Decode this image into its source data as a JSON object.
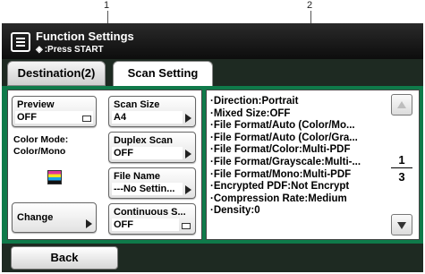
{
  "callouts": [
    "1",
    "2"
  ],
  "header": {
    "title": "Function Settings",
    "subtitle": ":Press START"
  },
  "tabs": [
    {
      "label": "Destination(2)",
      "active": false
    },
    {
      "label": "Scan Setting",
      "active": true
    }
  ],
  "left": {
    "preview": {
      "label": "Preview",
      "value": "OFF"
    },
    "color_mode": {
      "label": "Color Mode:",
      "value": "Color/Mono"
    },
    "change": {
      "label": "Change"
    },
    "scan_size": {
      "label": "Scan Size",
      "value": "A4"
    },
    "duplex_scan": {
      "label": "Duplex Scan",
      "value": "OFF"
    },
    "file_name": {
      "label": "File Name",
      "value": "---No Settin..."
    },
    "continuous_scan": {
      "label": "Continuous S...",
      "value": "OFF"
    }
  },
  "right": {
    "items": [
      "·Direction:Portrait",
      "·Mixed Size:OFF",
      "·File Format/Auto (Color/Mo...",
      "·File Format/Auto (Color/Gra...",
      "·File Format/Color:Multi-PDF",
      "·File Format/Grayscale:Multi-...",
      "·File Format/Mono:Multi-PDF",
      "·Encrypted PDF:Not Encrypt",
      "·Compression Rate:Medium",
      "·Density:0"
    ],
    "page_current": "1",
    "page_total": "3"
  },
  "footer": {
    "back_label": "Back"
  },
  "colors": {
    "header_bg": "#1a1a1a",
    "panel_green": "#0f7a4a",
    "strip_bg": "#1e2a22"
  }
}
